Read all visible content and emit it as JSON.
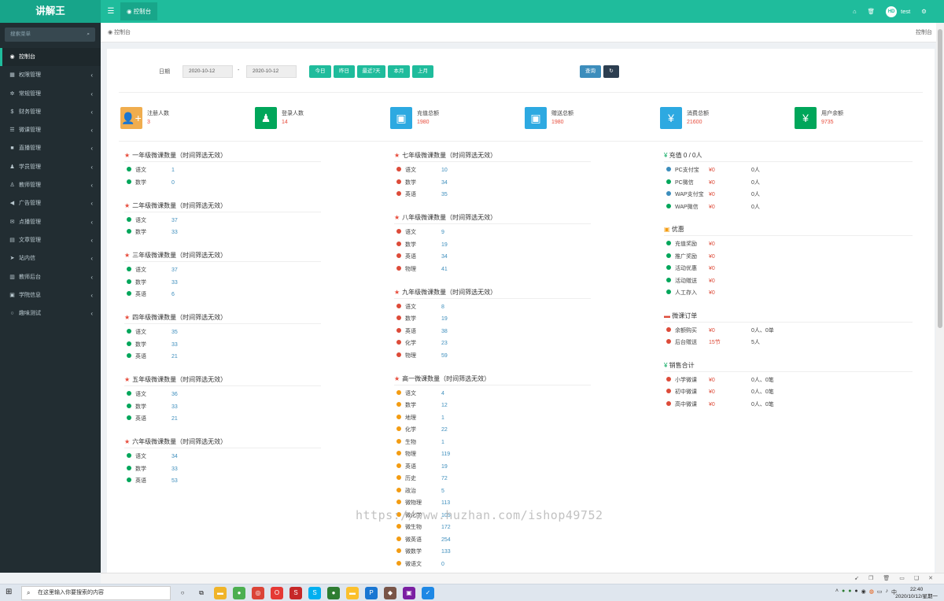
{
  "app": {
    "title": "讲解王",
    "tab": "控制台",
    "user": "test",
    "avatar": "HD"
  },
  "sidebar": {
    "search_placeholder": "搜索菜单",
    "items": [
      {
        "label": "控制台",
        "icon": "dashboard-icon",
        "glyph": "◉",
        "active": true
      },
      {
        "label": "权限管理",
        "icon": "grid-icon",
        "glyph": "▦"
      },
      {
        "label": "常规管理",
        "icon": "cogs-icon",
        "glyph": "✲"
      },
      {
        "label": "财务管理",
        "icon": "dollar-icon",
        "glyph": "$"
      },
      {
        "label": "微课管理",
        "icon": "list-icon",
        "glyph": "☰"
      },
      {
        "label": "直播管理",
        "icon": "video-icon",
        "glyph": "■"
      },
      {
        "label": "学员管理",
        "icon": "users-icon",
        "glyph": "♟"
      },
      {
        "label": "教师管理",
        "icon": "user-icon",
        "glyph": "♙"
      },
      {
        "label": "广告管理",
        "icon": "bullhorn-icon",
        "glyph": "◀"
      },
      {
        "label": "点播管理",
        "icon": "comments-icon",
        "glyph": "✉"
      },
      {
        "label": "文章管理",
        "icon": "file-icon",
        "glyph": "▤"
      },
      {
        "label": "站内信",
        "icon": "paper-plane-icon",
        "glyph": "➤"
      },
      {
        "label": "教师后台",
        "icon": "book-icon",
        "glyph": "▥"
      },
      {
        "label": "学院信息",
        "icon": "bank-icon",
        "glyph": "▣"
      },
      {
        "label": "趣味测试",
        "icon": "circle-icon",
        "glyph": "○"
      }
    ]
  },
  "breadcrumb": {
    "left": "控制台",
    "right": "控制台"
  },
  "filter": {
    "label": "日期",
    "start": "2020-10-12",
    "sep": "-",
    "end": "2020-10-12",
    "buttons": [
      "今日",
      "昨日",
      "最近7天",
      "本月",
      "上月"
    ],
    "query": "查询"
  },
  "stats": [
    {
      "title": "注册人数",
      "value": "3",
      "color": "#f0ad4e",
      "glyph": "👤+"
    },
    {
      "title": "登录人数",
      "value": "14",
      "color": "#00a65a",
      "glyph": "♟"
    },
    {
      "title": "充值总额",
      "value": "1980",
      "color": "#2da9e1",
      "glyph": "▣"
    },
    {
      "title": "赠送总额",
      "value": "1980",
      "color": "#2da9e1",
      "glyph": "▣"
    },
    {
      "title": "消费总额",
      "value": "21600",
      "color": "#2da9e1",
      "glyph": "¥"
    },
    {
      "title": "用户余额",
      "value": "9735",
      "color": "#00a65a",
      "glyph": "¥"
    }
  ],
  "col1": [
    {
      "title": "一年级微课数量（时间筛选无效）",
      "rows": [
        [
          "语文",
          "1"
        ],
        [
          "数学",
          "0"
        ]
      ]
    },
    {
      "title": "二年级微课数量（时间筛选无效）",
      "rows": [
        [
          "语文",
          "37"
        ],
        [
          "数学",
          "33"
        ]
      ]
    },
    {
      "title": "三年级微课数量（时间筛选无效）",
      "rows": [
        [
          "语文",
          "37"
        ],
        [
          "数学",
          "33"
        ],
        [
          "英语",
          "6"
        ]
      ]
    },
    {
      "title": "四年级微课数量（时间筛选无效）",
      "rows": [
        [
          "语文",
          "35"
        ],
        [
          "数学",
          "33"
        ],
        [
          "英语",
          "21"
        ]
      ]
    },
    {
      "title": "五年级微课数量（时间筛选无效）",
      "rows": [
        [
          "语文",
          "36"
        ],
        [
          "数学",
          "33"
        ],
        [
          "英语",
          "21"
        ]
      ]
    },
    {
      "title": "六年级微课数量（时间筛选无效）",
      "rows": [
        [
          "语文",
          "34"
        ],
        [
          "数学",
          "33"
        ],
        [
          "英语",
          "53"
        ]
      ]
    }
  ],
  "col2": [
    {
      "title": "七年级微课数量（时间筛选无效）",
      "rows": [
        [
          "语文",
          "10"
        ],
        [
          "数学",
          "34"
        ],
        [
          "英语",
          "35"
        ]
      ]
    },
    {
      "title": "八年级微课数量（时间筛选无效）",
      "rows": [
        [
          "语文",
          "9"
        ],
        [
          "数学",
          "19"
        ],
        [
          "英语",
          "34"
        ],
        [
          "物理",
          "41"
        ]
      ]
    },
    {
      "title": "九年级微课数量（时间筛选无效）",
      "rows": [
        [
          "语文",
          "8"
        ],
        [
          "数学",
          "19"
        ],
        [
          "英语",
          "38"
        ],
        [
          "化学",
          "23"
        ],
        [
          "物理",
          "59"
        ]
      ]
    },
    {
      "title": "高一微课数量（时间筛选无效）",
      "rows": [
        [
          "语文",
          "4"
        ],
        [
          "数学",
          "12"
        ],
        [
          "地理",
          "1"
        ],
        [
          "化学",
          "22"
        ],
        [
          "生物",
          "1"
        ],
        [
          "物理",
          "119"
        ],
        [
          "英语",
          "19"
        ],
        [
          "历史",
          "72"
        ],
        [
          "政治",
          "5"
        ],
        [
          "微物理",
          "113"
        ],
        [
          "微化学",
          "105"
        ],
        [
          "微生物",
          "172"
        ],
        [
          "微英语",
          "254"
        ],
        [
          "微数学",
          "133"
        ],
        [
          "微语文",
          "0"
        ]
      ]
    }
  ],
  "col3": {
    "recharge": {
      "title": "充值 0 / 0人",
      "rows": [
        [
          "PC支付宝",
          "¥0",
          "0人"
        ],
        [
          "PC微信",
          "¥0",
          "0人"
        ],
        [
          "WAP支付宝",
          "¥0",
          "0人"
        ],
        [
          "WAP微信",
          "¥0",
          "0人"
        ]
      ]
    },
    "discount": {
      "title": "优惠",
      "rows": [
        [
          "充值奖励",
          "¥0"
        ],
        [
          "推广奖励",
          "¥0"
        ],
        [
          "活动优惠",
          "¥0"
        ],
        [
          "活动赠送",
          "¥0"
        ],
        [
          "人工存入",
          "¥0"
        ]
      ]
    },
    "orders": {
      "title": "微课订单",
      "rows": [
        [
          "余额购买",
          "¥0",
          "0人、0单"
        ],
        [
          "后台赠送",
          "15节",
          "5人"
        ]
      ]
    },
    "sales": {
      "title": "销售合计",
      "rows": [
        [
          "小学微课",
          "¥0",
          "0人、0笔"
        ],
        [
          "初中微课",
          "¥0",
          "0人、0笔"
        ],
        [
          "高中微课",
          "¥0",
          "0人、0笔"
        ]
      ]
    }
  },
  "watermark": "https://www.huzhan.com/ishop49752",
  "taskbar": {
    "search": "在这里输入你要搜索的内容",
    "time": "22:40",
    "date": "2020/10/12/星期一"
  }
}
